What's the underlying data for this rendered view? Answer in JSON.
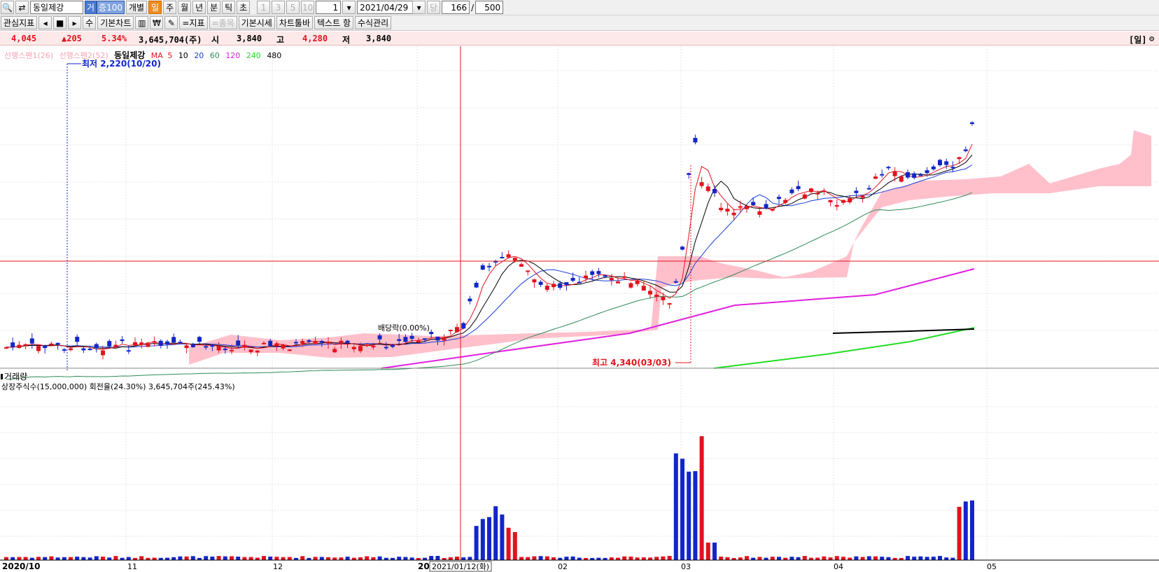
{
  "toolbar": {
    "stock_name": "동일제강",
    "tag_ge": "거",
    "tag_jeung": "증100",
    "individual": "개별",
    "periods": [
      "일",
      "주",
      "월",
      "년",
      "분",
      "틱",
      "초"
    ],
    "active_period": "일",
    "intervals": [
      "1",
      "3",
      "5",
      "10"
    ],
    "interval_value": "1",
    "date": "2021/04/29",
    "dang": "당",
    "count": "166",
    "slash": "/",
    "total": "500",
    "interest_indicator": "관심지표",
    "su": "수",
    "basic_chart": "기본차트",
    "won": "₩",
    "indicator": "=지표",
    "stock": "=종목",
    "basic_quote": "기본시세",
    "chart_toolbar": "차트툴바",
    "text_item": "텍스트 항",
    "formula_manage": "수식관리"
  },
  "quote": {
    "price": "4,045",
    "change": "▲205",
    "change_pct": "5.34%",
    "volume": "3,645,704(주)",
    "open_label": "시",
    "open": "3,840",
    "high_label": "고",
    "high": "4,280",
    "low_label": "저",
    "low": "3,840",
    "period_tag": "[일]"
  },
  "legend": {
    "span1": "선행스팬1(26)",
    "span2": "선행스팬2(52)",
    "name": "동일제강",
    "ma_label": "MA",
    "ma": [
      "5",
      "10",
      "20",
      "60",
      "120",
      "240",
      "480"
    ]
  },
  "annotations": {
    "low": "최저 2,220(10/20)",
    "high": "최고 4,340(03/03)",
    "dividend": "배당락(0.00%)"
  },
  "volume_panel": {
    "title": "거래량",
    "info": "상장주식수(15,000,000) 회전율(24.30%) 3,645,704주(245.43%)"
  },
  "xaxis": {
    "labels": [
      "2020/10",
      "11",
      "12",
      "2021",
      "02",
      "03",
      "04",
      "05"
    ],
    "cursor_date": "2021/01/12(화)"
  },
  "colors": {
    "up": "#e0141e",
    "down": "#1226c8",
    "ma5": "#e0141e",
    "ma10": "#000000",
    "ma20": "#1a3cd8",
    "ma60": "#2e8b57",
    "ma120": "#e020e0",
    "ma240": "#22dd22",
    "ma480": "#000000",
    "cloud": "#ffc0cb"
  },
  "chart_data": {
    "type": "candlestick",
    "period": "daily",
    "range": [
      "2020/10",
      "2021/05"
    ],
    "ohlc_keypoints": [
      {
        "label": "2020/10/20",
        "low": 2220
      },
      {
        "label": "2021/03/03",
        "high": 4340
      },
      {
        "label": "2021/04/29",
        "open": 3840,
        "high": 4280,
        "low": 3840,
        "close": 4045
      }
    ],
    "volume_info": {
      "listed_shares": 15000000,
      "turnover_pct": 24.3,
      "last_volume": 3645704
    },
    "moving_averages": [
      5,
      10,
      20,
      60,
      120,
      240,
      480
    ],
    "ichimoku": [
      "선행스팬1(26)",
      "선행스팬2(52)"
    ]
  }
}
